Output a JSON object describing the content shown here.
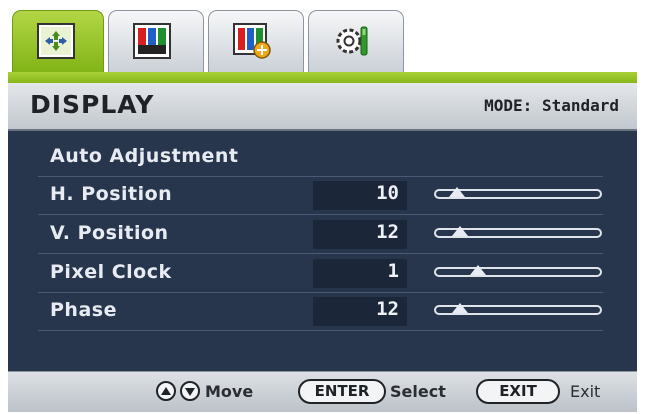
{
  "tabs": [
    {
      "icon": "display-settings-icon",
      "active": true
    },
    {
      "icon": "picture-icon",
      "active": false
    },
    {
      "icon": "picture-advanced-icon",
      "active": false
    },
    {
      "icon": "system-gear-icon",
      "active": false
    }
  ],
  "header": {
    "title": "DISPLAY",
    "mode": "MODE: Standard"
  },
  "menu": {
    "items": [
      {
        "label": "Auto Adjustment"
      },
      {
        "label": "H. Position",
        "value": "10",
        "level": 0.1
      },
      {
        "label": "V. Position",
        "value": "12",
        "level": 0.12
      },
      {
        "label": "Pixel Clock",
        "value": "1",
        "level": 0.24
      },
      {
        "label": "Phase",
        "value": "12",
        "level": 0.12
      }
    ]
  },
  "footer": {
    "move_label": "Move",
    "enter_key": "ENTER",
    "select_label": "Select",
    "exit_key": "EXIT",
    "exit_label": "Exit"
  },
  "colors": {
    "accent": "#8fc21f",
    "panel": "#27364d",
    "header": "#d4d9de"
  }
}
